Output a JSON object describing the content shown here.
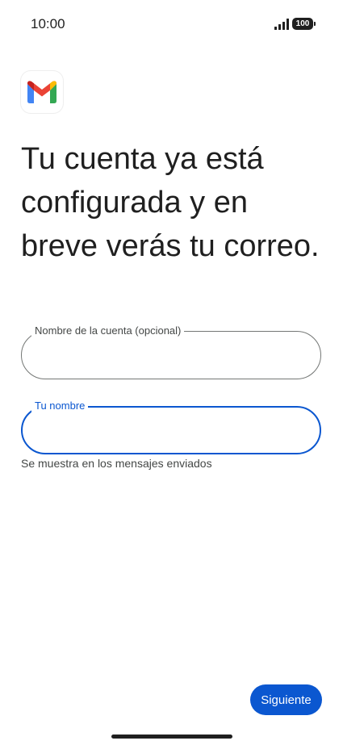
{
  "status_bar": {
    "time": "10:00",
    "battery_level": "100"
  },
  "app": {
    "logo_icon": "gmail-logo-icon"
  },
  "headline": "Tu cuenta ya está configurada y en breve verás tu correo.",
  "form": {
    "account_name": {
      "label": "Nombre de la cuenta (opcional)",
      "value": ""
    },
    "your_name": {
      "label": "Tu nombre",
      "value": "",
      "helper": "Se muestra en los mensajes enviados"
    }
  },
  "actions": {
    "next_label": "Siguiente"
  },
  "colors": {
    "accent": "#0b57d0",
    "gmail_red": "#ea4335",
    "gmail_blue": "#4285f4",
    "gmail_green": "#34a853",
    "gmail_yellow": "#fbbc04",
    "gmail_dark_red": "#c5221f"
  }
}
